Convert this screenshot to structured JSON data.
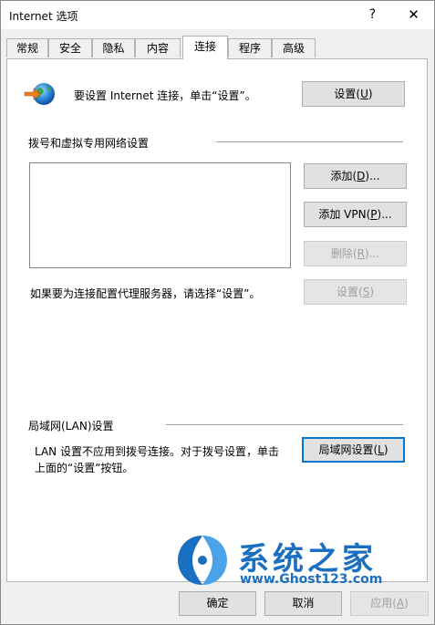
{
  "window": {
    "title": "Internet 选项",
    "help_label": "?",
    "close_label": "✕"
  },
  "tabs": [
    {
      "label": "常规"
    },
    {
      "label": "安全"
    },
    {
      "label": "隐私"
    },
    {
      "label": "内容"
    },
    {
      "label": "连接",
      "active": true
    },
    {
      "label": "程序"
    },
    {
      "label": "高级"
    }
  ],
  "setup": {
    "icon": "globe-arrow-icon",
    "text": "要设置 Internet 连接，单击“设置”。",
    "button_label": "设置(",
    "button_key": "U",
    "button_end": ")"
  },
  "dialup": {
    "section_title": "拨号和虚拟专用网络设置",
    "add_label": "添加(",
    "add_key": "D",
    "add_end": ")...",
    "add_vpn_label": "添加 VPN(",
    "add_vpn_key": "P",
    "add_vpn_end": ")...",
    "remove_label": "删除(",
    "remove_key": "R",
    "remove_end": ")...",
    "proxy_text": "如果要为连接配置代理服务器，请选择“设置”。",
    "settings_label": "设置(",
    "settings_key": "S",
    "settings_end": ")"
  },
  "lan": {
    "section_title": "局域网(LAN)设置",
    "line1": "LAN 设置不应用到拨号连接。对于拨号设置，单击",
    "line2": "上面的“设置”按钮。",
    "button_label": "局域网设置(",
    "button_key": "L",
    "button_end": ")"
  },
  "watermark": {
    "title": "系统之家",
    "url": "www.Ghost123.com"
  },
  "footer": {
    "ok_label": "确定",
    "cancel_label": "取消",
    "apply_label": "应用(",
    "apply_key": "A",
    "apply_end": ")"
  }
}
